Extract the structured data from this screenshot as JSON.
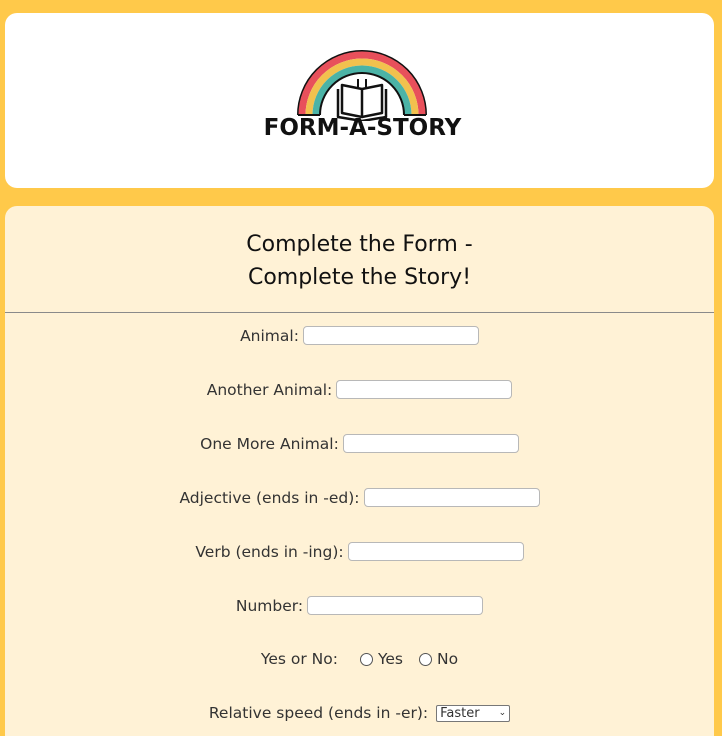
{
  "header": {
    "logo_text": "FORM-A-STORY"
  },
  "form": {
    "title_line1": "Complete the Form -",
    "title_line2": "Complete the Story!",
    "fields": {
      "animal_label": "Animal:",
      "another_animal_label": "Another Animal:",
      "one_more_animal_label": "One More Animal:",
      "adjective_label": "Adjective (ends in -ed):",
      "verb_label": "Verb (ends in -ing):",
      "number_label": "Number:",
      "yes_no_label": "Yes or No:",
      "yes_option": "Yes",
      "no_option": "No",
      "speed_label": "Relative speed (ends in -er):",
      "speed_selected": "Faster"
    }
  },
  "colors": {
    "page_background": "#ffc94a",
    "form_background": "#fff2d6",
    "rainbow": [
      "#e8505b",
      "#f2c14e",
      "#4bb3a6"
    ]
  }
}
